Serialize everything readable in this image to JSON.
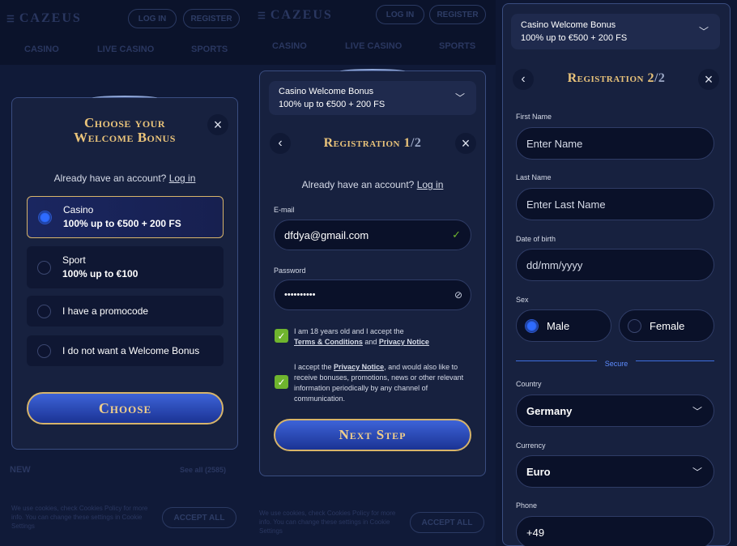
{
  "bg": {
    "logo": "CAZEUS",
    "login": "LOG IN",
    "register": "REGISTER",
    "nav": [
      "CASINO",
      "LIVE CASINO",
      "SPORTS"
    ],
    "new_label": "NEW",
    "see_all": "See all (2585)",
    "cookie_text": "We use cookies, check Cookies Policy for more info. You can change these settings in Cookie Settings",
    "accept_all": "ACCEPT ALL"
  },
  "step0": {
    "title_line1": "Choose your",
    "title_line2": "Welcome Bonus",
    "have_account": "Already have an account?",
    "login_link": "Log in",
    "options": [
      {
        "line1": "Casino",
        "line2": "100% up to €500 + 200 FS",
        "selected": true
      },
      {
        "line1": "Sport",
        "line2": "100% up to €100",
        "selected": false
      },
      {
        "line1": "I have a promocode",
        "line2": "",
        "selected": false
      },
      {
        "line1": "I do not want a Welcome Bonus",
        "line2": "",
        "selected": false
      }
    ],
    "choose_button": "Choose"
  },
  "bonus": {
    "title": "Casino Welcome Bonus",
    "value": "100% up to €500 + 200 FS"
  },
  "step1": {
    "title": "Registration 1",
    "title_suffix": "/2",
    "have_account": "Already have an account?",
    "login_link": "Log in",
    "email_label": "E-mail",
    "email_value": "dfdya@gmail.com",
    "password_label": "Password",
    "password_value": "••••••••••",
    "consent1_pre": "I am 18 years old and I accept the",
    "consent1_terms": "Terms & Conditions",
    "consent1_and": "and",
    "consent1_privacy": "Privacy Notice",
    "consent2_pre": "I accept the",
    "consent2_privacy": "Privacy Notice",
    "consent2_post": ", and would also like to receive bonuses, promotions, news or other relevant information periodically by any channel of communication.",
    "next_button": "Next Step"
  },
  "step2": {
    "title": "Registration 2",
    "title_suffix": "/2",
    "first_name_label": "First Name",
    "first_name_placeholder": "Enter Name",
    "last_name_label": "Last Name",
    "last_name_placeholder": "Enter Last Name",
    "dob_label": "Date of birth",
    "dob_placeholder": "dd/mm/yyyy",
    "sex_label": "Sex",
    "male": "Male",
    "female": "Female",
    "secure": "Secure",
    "country_label": "Country",
    "country_value": "Germany",
    "currency_label": "Currency",
    "currency_value": "Euro",
    "phone_label": "Phone",
    "phone_value": "+49"
  },
  "colors": {
    "gold": "#e9c37a",
    "accent_blue": "#2e6bff",
    "check_green": "#6fb52e"
  }
}
